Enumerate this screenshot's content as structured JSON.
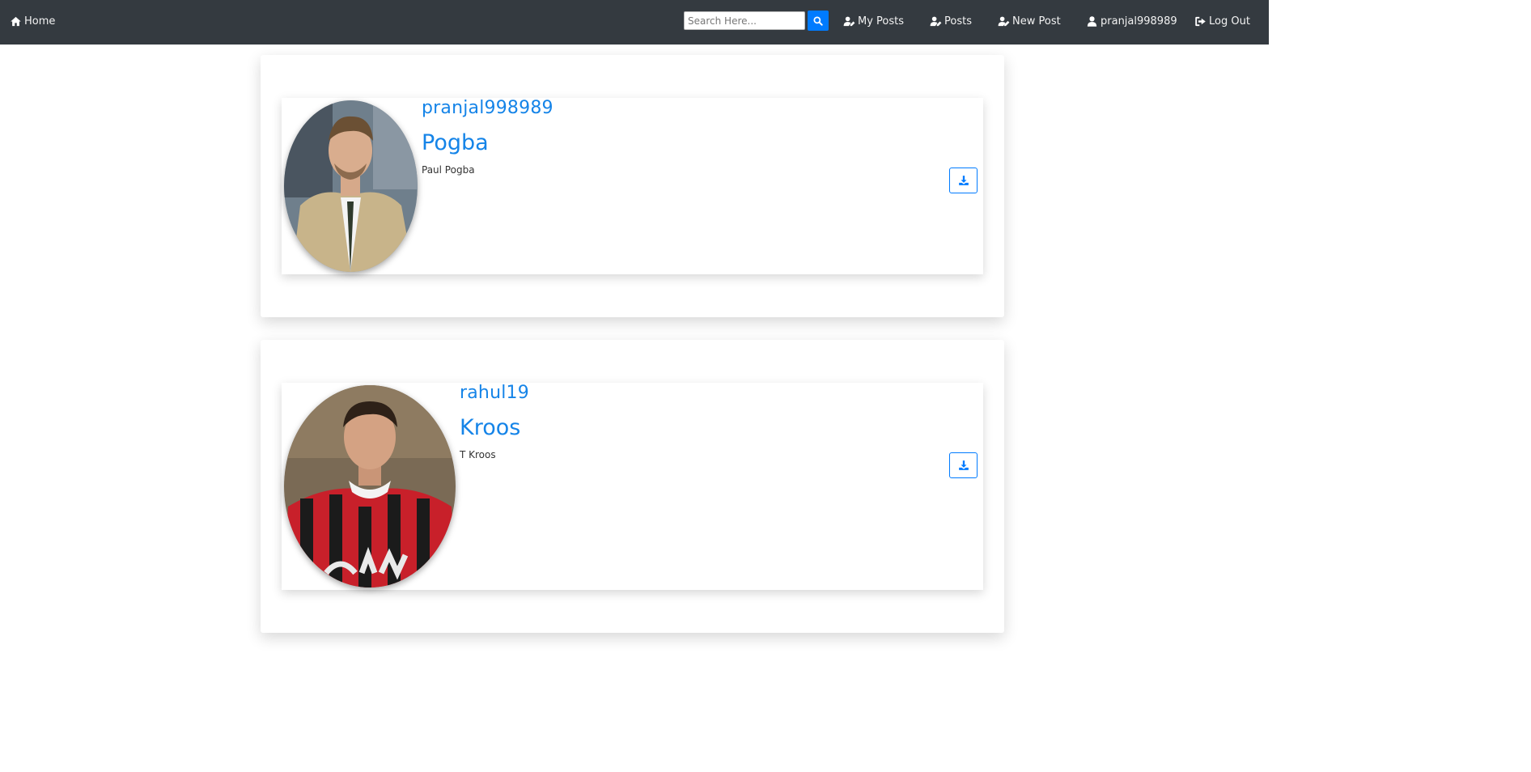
{
  "navbar": {
    "home_label": "Home",
    "search_placeholder": "Search Here...",
    "my_posts_label": "My Posts",
    "posts_label": "Posts",
    "new_post_label": "New Post",
    "user_label": "pranjal998989",
    "logout_label": "Log Out"
  },
  "posts": [
    {
      "username": "pranjal998989",
      "title": "Pogba",
      "description": "Paul Pogba"
    },
    {
      "username": "rahul19",
      "title": "Kroos",
      "description": "T Kroos"
    }
  ],
  "colors": {
    "navbar_bg": "#343a40",
    "accent": "#007bff",
    "link": "#1584e8"
  },
  "icons": {
    "home": "home-icon",
    "search": "search-icon",
    "my_posts": "user-edit-icon",
    "posts": "user-edit-icon",
    "new_post": "user-pen-icon",
    "user": "user-icon",
    "logout": "sign-out-icon",
    "download": "download-icon"
  }
}
